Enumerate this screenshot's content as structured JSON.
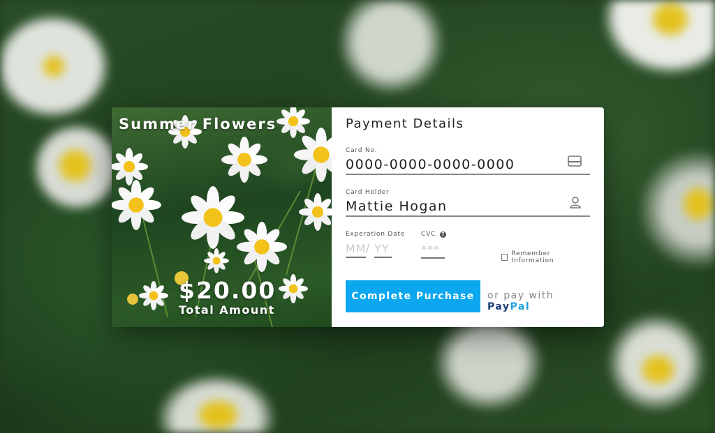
{
  "product": {
    "title": "Summer Flowers",
    "price": "$20.00",
    "price_label": "Total Amount"
  },
  "form": {
    "title": "Payment Details",
    "card_number": {
      "label": "Card No.",
      "value": "0000-0000-0000-0000",
      "icon": "credit-card-icon"
    },
    "card_holder": {
      "label": "Card Holder",
      "value": "Mattie Hogan",
      "icon": "user-icon"
    },
    "expiration": {
      "label": "Experation Date",
      "month_placeholder": "MM",
      "separator": "/",
      "year_placeholder": "YY"
    },
    "cvc": {
      "label": "CVC",
      "placeholder": "***",
      "icon": "help-icon"
    },
    "remember": {
      "label": "Remember Information",
      "checked": false
    },
    "submit_label": "Complete Purchase",
    "alt_text": "or pay with",
    "paypal_1": "Pay",
    "paypal_2": "Pal"
  },
  "colors": {
    "accent": "#0ca7ee",
    "paypal_dark": "#1b3d7a",
    "paypal_light": "#1ea0dc"
  }
}
